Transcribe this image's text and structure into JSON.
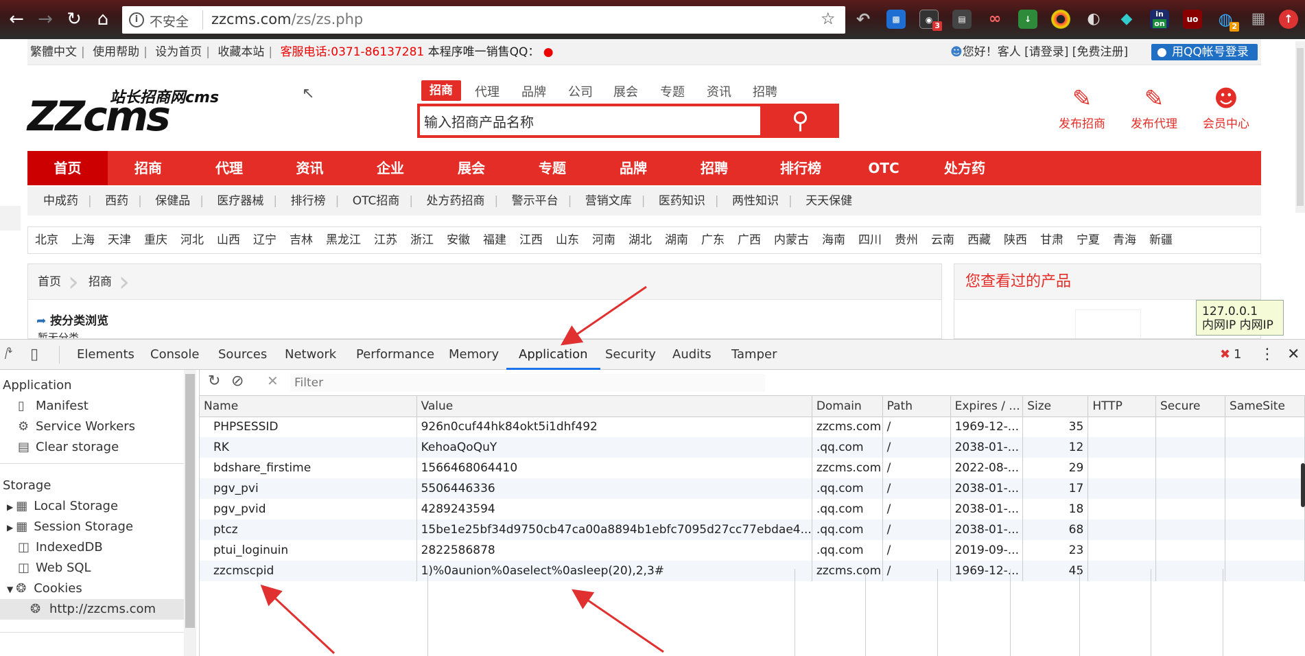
{
  "browser": {
    "insecure_label": "不安全",
    "url_host": "zzcms.com",
    "url_path": "/zs/zs.php",
    "ext_badges": [
      "3",
      "on",
      "2"
    ]
  },
  "site": {
    "top_links": [
      "繁體中文",
      "使用帮助",
      "设为首页",
      "收藏本站"
    ],
    "hotline": "客服电话:0371-86137281",
    "qq_note": "本程序唯一销售QQ：",
    "greeting": "您好！客人 [请登录] [免费注册]",
    "qq_login": "用QQ帐号登录",
    "logo_sub": "站长招商网cms",
    "logo_main": "ZZcms",
    "search_tabs": [
      "招商",
      "代理",
      "品牌",
      "公司",
      "展会",
      "专题",
      "资讯",
      "招聘"
    ],
    "search_placeholder": "输入招商产品名称",
    "header_links": [
      "发布招商",
      "发布代理",
      "会员中心"
    ],
    "main_nav": [
      "首页",
      "招商",
      "代理",
      "资讯",
      "企业",
      "展会",
      "专题",
      "品牌",
      "招聘",
      "排行榜",
      "OTC",
      "处方药"
    ],
    "sub_nav": [
      "中成药",
      "西药",
      "保健品",
      "医疗器械",
      "排行榜",
      "OTC招商",
      "处方药招商",
      "警示平台",
      "营销文库",
      "医药知识",
      "两性知识",
      "天天保健"
    ],
    "regions": [
      "北京",
      "上海",
      "天津",
      "重庆",
      "河北",
      "山西",
      "辽宁",
      "吉林",
      "黑龙江",
      "江苏",
      "浙江",
      "安徽",
      "福建",
      "江西",
      "山东",
      "河南",
      "湖北",
      "湖南",
      "广东",
      "广西",
      "内蒙古",
      "海南",
      "四川",
      "贵州",
      "云南",
      "西藏",
      "陕西",
      "甘肃",
      "宁夏",
      "青海",
      "新疆"
    ],
    "breadcrumb": [
      "首页",
      "招商"
    ],
    "category_title": "按分类浏览",
    "category_cut": "暂无分类",
    "viewed_title": "您查看过的产品",
    "ip_line1": "127.0.0.1",
    "ip_line2": "内网IP 内网IP"
  },
  "devtools": {
    "tabs": [
      "Elements",
      "Console",
      "Sources",
      "Network",
      "Performance",
      "Memory",
      "Application",
      "Security",
      "Audits",
      "Tamper"
    ],
    "active_tab": "Application",
    "error_count": "1",
    "sidebar": {
      "application_header": "Application",
      "application_items": [
        "Manifest",
        "Service Workers",
        "Clear storage"
      ],
      "storage_header": "Storage",
      "storage_items": [
        "Local Storage",
        "Session Storage",
        "IndexedDB",
        "Web SQL",
        "Cookies"
      ],
      "cookie_origin": "http://zzcms.com"
    },
    "filter_placeholder": "Filter",
    "columns": [
      "Name",
      "Value",
      "Domain",
      "Path",
      "Expires / ...",
      "Size",
      "HTTP",
      "Secure",
      "SameSite"
    ],
    "cookies": [
      {
        "name": "PHPSESSID",
        "value": "926n0cuf44hk84okt5i1dhf492",
        "domain": "zzcms.com",
        "path": "/",
        "expires": "1969-12-...",
        "size": "35"
      },
      {
        "name": "RK",
        "value": "KehoaQoQuY",
        "domain": ".qq.com",
        "path": "/",
        "expires": "2038-01-...",
        "size": "12"
      },
      {
        "name": "bdshare_firstime",
        "value": "1566468064410",
        "domain": "zzcms.com",
        "path": "/",
        "expires": "2022-08-...",
        "size": "29"
      },
      {
        "name": "pgv_pvi",
        "value": "5506446336",
        "domain": ".qq.com",
        "path": "/",
        "expires": "2038-01-...",
        "size": "17"
      },
      {
        "name": "pgv_pvid",
        "value": "4289243594",
        "domain": ".qq.com",
        "path": "/",
        "expires": "2038-01-...",
        "size": "18"
      },
      {
        "name": "ptcz",
        "value": "15be1e25bf34d9750cb47ca00a8894b1ebfc7095d27cc77ebdae4...",
        "domain": ".qq.com",
        "path": "/",
        "expires": "2038-01-...",
        "size": "68"
      },
      {
        "name": "ptui_loginuin",
        "value": "2822586878",
        "domain": ".qq.com",
        "path": "/",
        "expires": "2019-09-...",
        "size": "23"
      },
      {
        "name": "zzcmscpid",
        "value": "1)%0aunion%0aselect%0asleep(20),2,3#",
        "domain": "zzcms.com",
        "path": "/",
        "expires": "1969-12-...",
        "size": "45"
      }
    ]
  },
  "colors": {
    "brand_red": "#e52d27",
    "annotation_red": "#e03030",
    "active_tab_blue": "#1a73e8"
  }
}
